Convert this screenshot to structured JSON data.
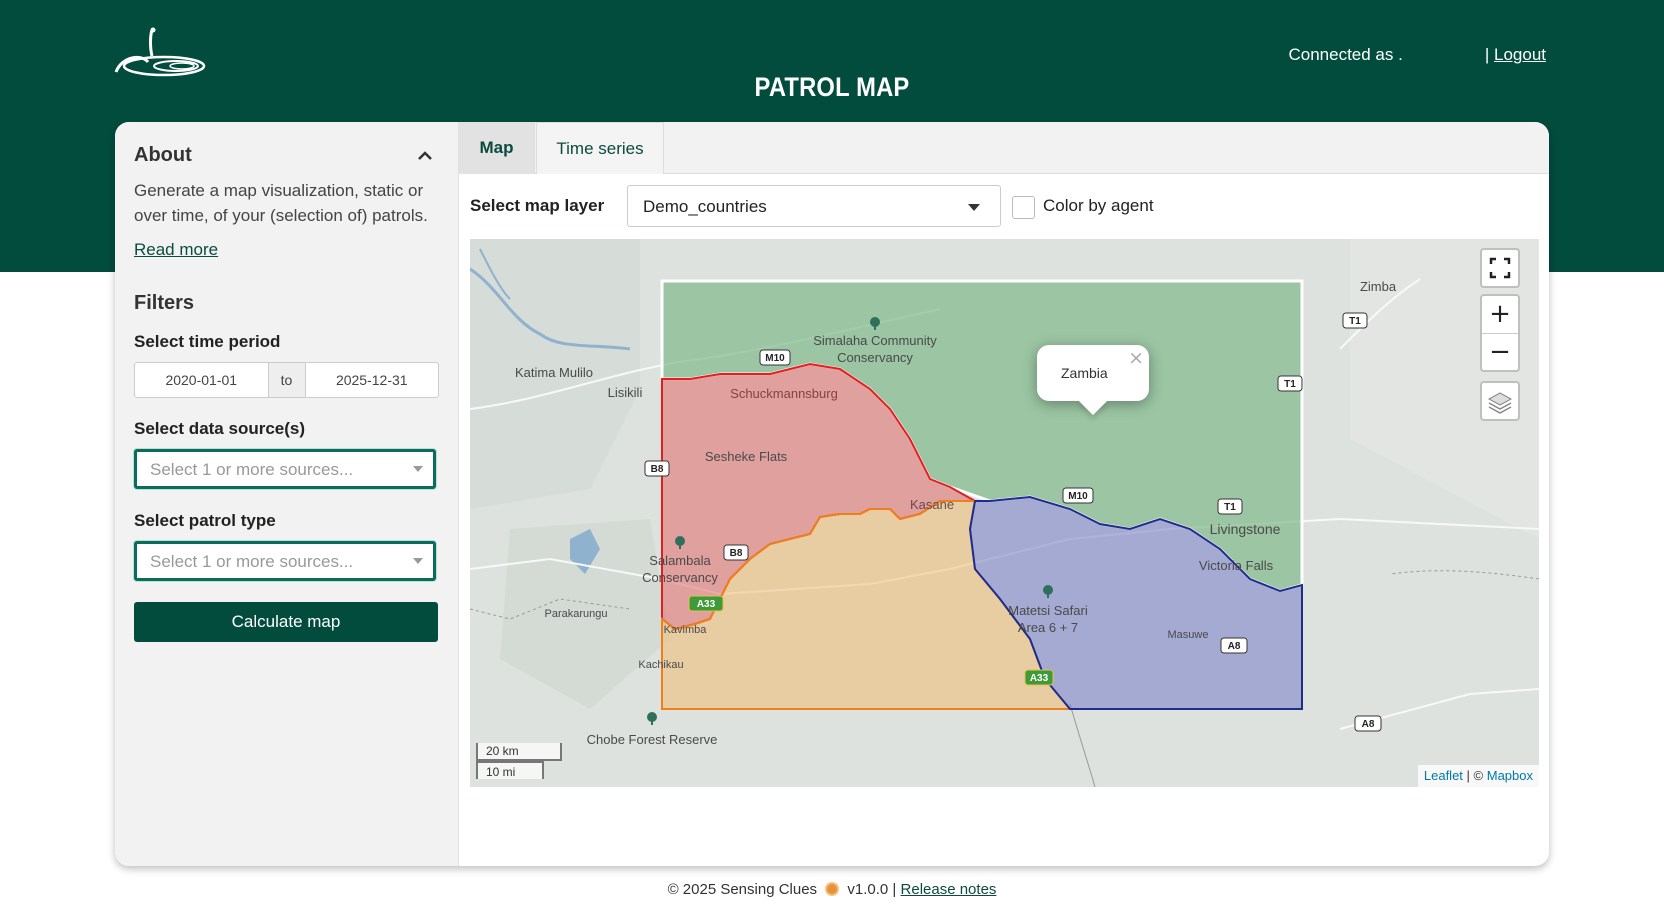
{
  "header": {
    "title": "PATROL MAP",
    "connected_label": "Connected as",
    "username": ".",
    "separator": "|",
    "logout_label": "Logout"
  },
  "sidebar": {
    "about_title": "About",
    "about_text": "Generate a map visualization, static or over time, of your (selection of) patrols.",
    "read_more": "Read more",
    "filters_title": "Filters",
    "time_period_label": "Select time period",
    "date_from": "2020-01-01",
    "date_to_sep": "to",
    "date_to": "2025-12-31",
    "data_source_label": "Select data source(s)",
    "data_source_placeholder": "Select 1 or more sources...",
    "patrol_type_label": "Select patrol type",
    "patrol_type_placeholder": "Select 1 or more sources...",
    "calculate_button": "Calculate map"
  },
  "tabs": [
    {
      "label": "Map",
      "active": true
    },
    {
      "label": "Time series",
      "active": false
    }
  ],
  "map_controls": {
    "layer_label": "Select map layer",
    "layer_value": "Demo_countries",
    "color_by_agent_label": "Color by agent",
    "color_by_agent_checked": false
  },
  "map": {
    "popup_text": "Zambia",
    "scale_km": "20 km",
    "scale_mi": "10 mi",
    "attribution_leaflet": "Leaflet",
    "attribution_sep": "| ©",
    "attribution_mapbox": "Mapbox",
    "labels": {
      "zimba": "Zimba",
      "katima": "Katima Mulilo",
      "lisikili": "Lisikili",
      "simalaha_1": "Simalaha Community",
      "simalaha_2": "Conservancy",
      "schuckmannsburg": "Schuckmannsburg",
      "sesheke": "Sesheke Flats",
      "kasane": "Kasane",
      "livingstone": "Livingstone",
      "victoria_falls": "Victoria Falls",
      "salambala_1": "Salambala",
      "salambala_2": "Conservancy",
      "parakarungu": "Parakarungu",
      "kavimba": "Kavimba",
      "kachikau": "Kachikau",
      "matetsi_1": "Matetsi Safari",
      "matetsi_2": "Area 6 + 7",
      "masuwe": "Masuwe",
      "chobe": "Chobe Forest Reserve"
    },
    "road_shields": {
      "m10_a": "M10",
      "m10_b": "M10",
      "b8_a": "B8",
      "b8_b": "B8",
      "t1_a": "T1",
      "t1_b": "T1",
      "t1_c": "T1",
      "a8_a": "A8",
      "a8_b": "A8",
      "a33_a": "A33",
      "a33_b": "A33"
    },
    "country_colors": {
      "zambia": "#7fb98a",
      "namibia": "#e06a6a",
      "botswana": "#f1bb72",
      "zimbabwe": "#7f86c8"
    }
  },
  "footer": {
    "copyright": "© 2025 Sensing Clues",
    "version": "v1.0.0 |",
    "release_notes": "Release notes"
  }
}
